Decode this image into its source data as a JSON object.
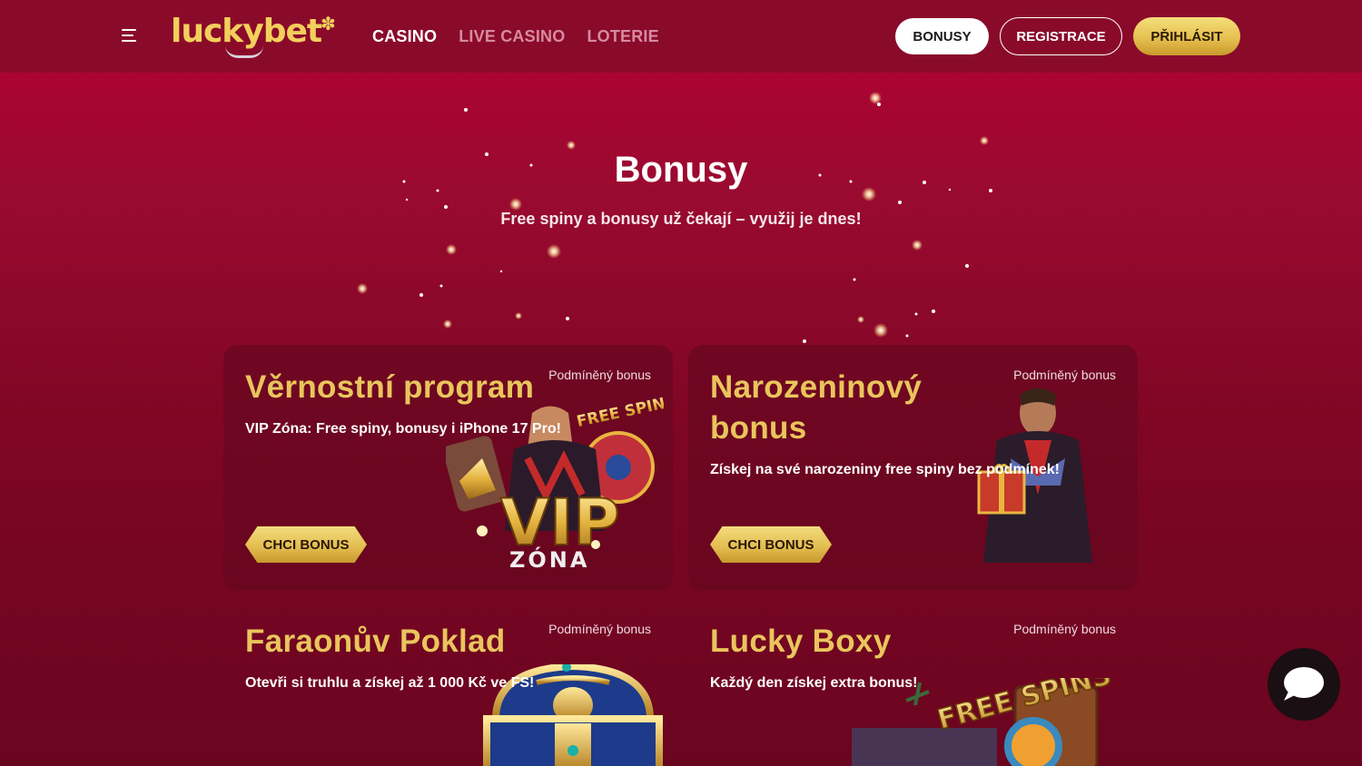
{
  "header": {
    "logo_text": "luckybet",
    "nav": [
      "CASINO",
      "LIVE CASINO",
      "LOTERIE"
    ],
    "buttons": {
      "bonusy": "BONUSY",
      "registrace": "REGISTRACE",
      "prihlasit": "PŘIHLÁSIT"
    }
  },
  "hero": {
    "title": "Bonusy",
    "subtitle": "Free spiny a bonusy už čekají – využij je dnes!"
  },
  "cards": [
    {
      "title": "Věrnostní program",
      "tag": "Podmíněný bonus",
      "description": "VIP Zóna: Free spiny, bonusy i iPhone 17 Pro!",
      "button": "CHCI BONUS",
      "art_text": [
        "FREE SPINS",
        "VIP",
        "ZÓNA"
      ]
    },
    {
      "title_lines": [
        "Narozeninový",
        "bonus"
      ],
      "tag": "Podmíněný bonus",
      "description": "Získej na své narozeniny free spiny bez podmínek!",
      "button": "CHCI BONUS"
    },
    {
      "title": "Faraonův Poklad",
      "tag": "Podmíněný bonus",
      "description": "Otevři si truhlu a získej až 1 000 Kč ve FS!"
    },
    {
      "title": "Lucky Boxy",
      "tag": "Podmíněný bonus",
      "description": "Každý den získej extra bonus!",
      "art_text": [
        "FREE SPINS"
      ]
    }
  ],
  "colors": {
    "gold": "#e9c55c",
    "header_bg": "#8a0a2a",
    "card_bg": "#700722"
  }
}
